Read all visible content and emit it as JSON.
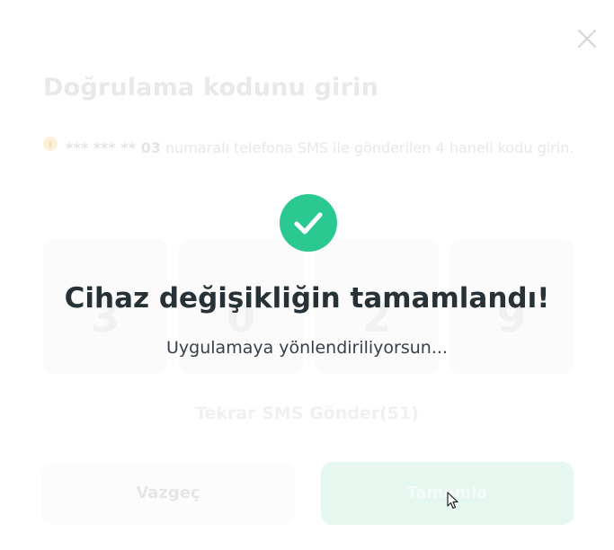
{
  "modal": {
    "close_icon": "close-icon",
    "title": "Doğrulama kodunu girin",
    "info": {
      "icon": "info-icon",
      "masked_number": "*** *** ** 03",
      "text": " numaralı telefona SMS ile gönderilen 4 haneli kodu girin."
    },
    "code_digits": [
      "3",
      "0",
      "2",
      "9"
    ],
    "resend_label": "Tekrar SMS Gönder",
    "resend_countdown": "(51)",
    "buttons": {
      "cancel_label": "Vazgeç",
      "complete_label": "Tamamla"
    }
  },
  "success": {
    "icon": "check-circle-icon",
    "title": "Cihaz değişikliğin tamamlandı!",
    "subtitle": "Uygulamaya yönlendiriliyorsun...",
    "accent_color": "#2bc992"
  }
}
